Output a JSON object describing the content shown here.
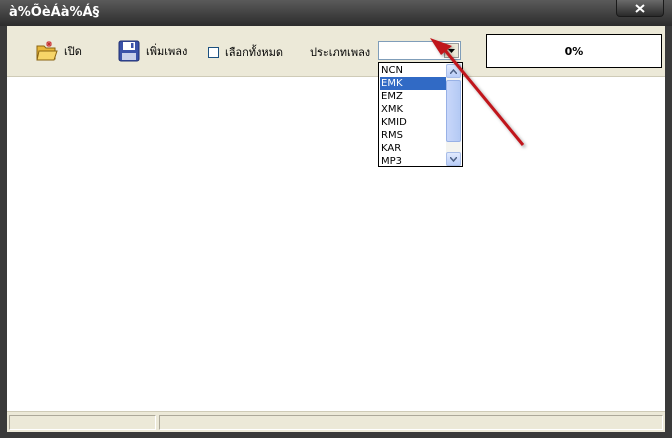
{
  "window": {
    "title": "à%ÕèÁà%Á§",
    "close_icon": "close-icon"
  },
  "toolbar": {
    "open_label": "เปิด",
    "open_icon": "open-folder-icon",
    "add_song_label": "เพิ่มเพลง",
    "add_song_icon": "floppy-disk-icon",
    "select_all_label": "เลือกทั้งหมด",
    "select_all_checked": false,
    "song_type_label": "ประเภทเพลง",
    "song_type_value": "",
    "progress_text": "0%",
    "progress_value": 0
  },
  "dropdown": {
    "options": [
      "NCN",
      "EMK",
      "EMZ",
      "XMK",
      "KMID",
      "RMS",
      "KAR",
      "MP3"
    ],
    "highlighted": "EMK"
  },
  "annotation": {
    "arrow_color": "#c0141c"
  }
}
